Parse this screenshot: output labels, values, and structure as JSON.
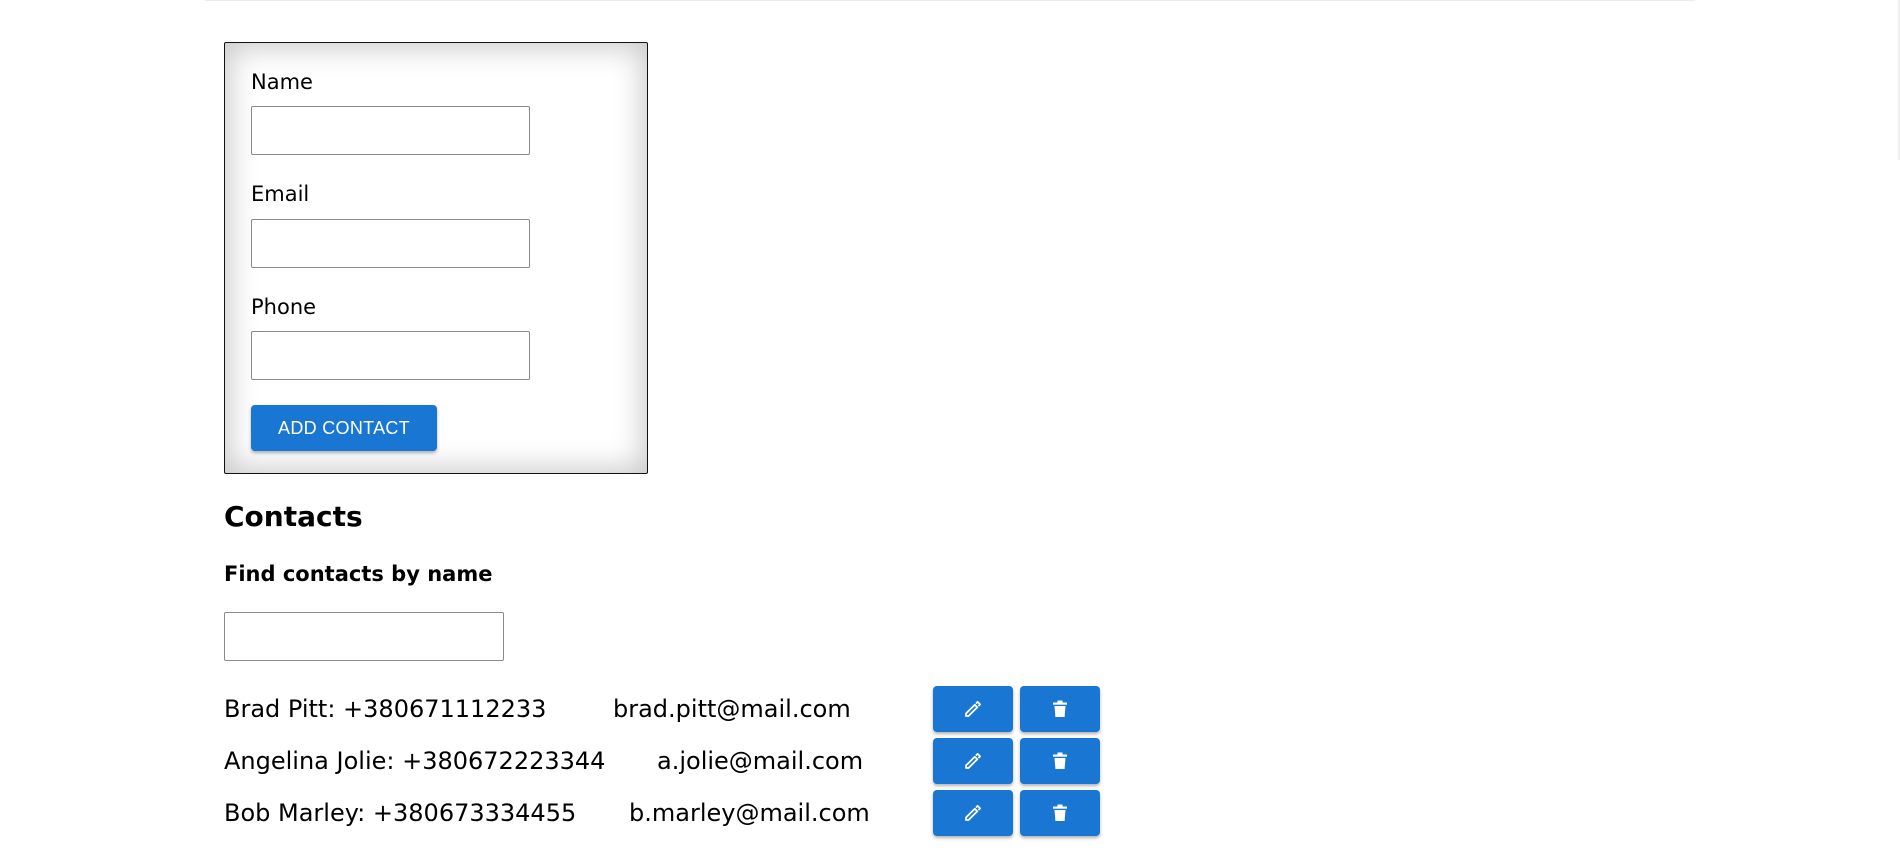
{
  "form": {
    "name_label": "Name",
    "name_value": "",
    "email_label": "Email",
    "email_value": "",
    "phone_label": "Phone",
    "phone_value": "",
    "submit_label": "ADD CONTACT"
  },
  "contacts": {
    "title": "Contacts",
    "filter_label": "Find contacts by name",
    "filter_value": "",
    "items": [
      {
        "name_phone": "Brad Pitt: +380671112233",
        "email": "brad.pitt@mail.com"
      },
      {
        "name_phone": "Angelina Jolie: +380672223344",
        "email": "a.jolie@mail.com"
      },
      {
        "name_phone": "Bob Marley: +380673334455",
        "email": "b.marley@mail.com"
      }
    ],
    "edit_icon": "pencil-icon",
    "delete_icon": "trash-icon"
  },
  "colors": {
    "primary": "#1976d2",
    "button_text": "#ffffff"
  }
}
